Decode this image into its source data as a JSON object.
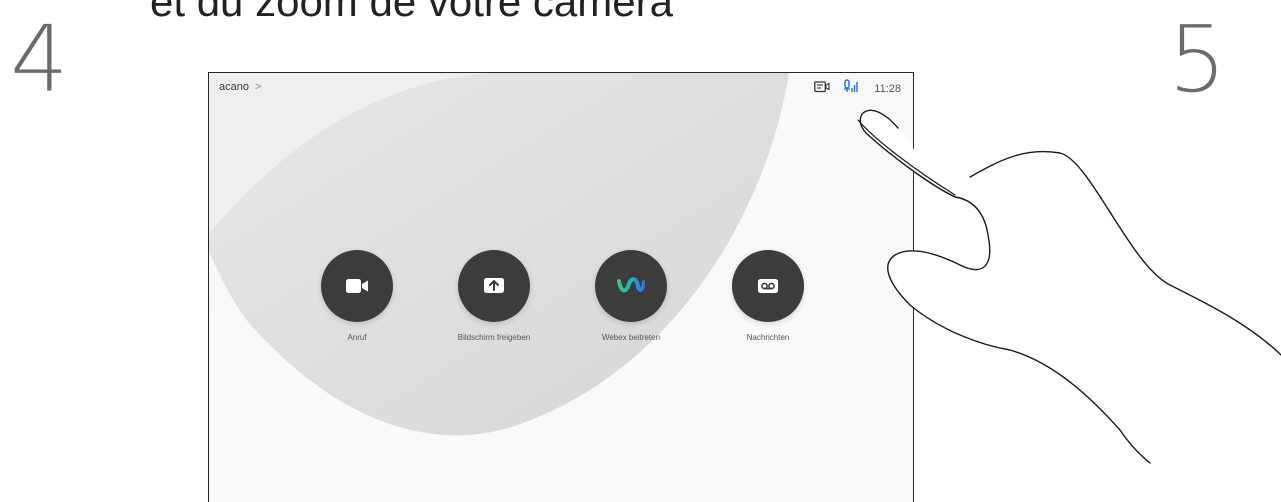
{
  "page": {
    "heading": "et du zoom de votre caméra",
    "step_left": "4",
    "step_right": "5"
  },
  "device": {
    "brand": "acano",
    "chevron": ">",
    "clock": "11:28",
    "icons": [
      "camera-control-icon",
      "microphone-icon"
    ],
    "accent_color": "#1e6ed8"
  },
  "actions": [
    {
      "label": "Anruf",
      "icon": "video-camera-icon"
    },
    {
      "label": "Bildschirm freigeben",
      "icon": "share-screen-icon"
    },
    {
      "label": "Webex beitreten",
      "icon": "webex-icon"
    },
    {
      "label": "Nachrichten",
      "icon": "voicemail-icon"
    }
  ]
}
